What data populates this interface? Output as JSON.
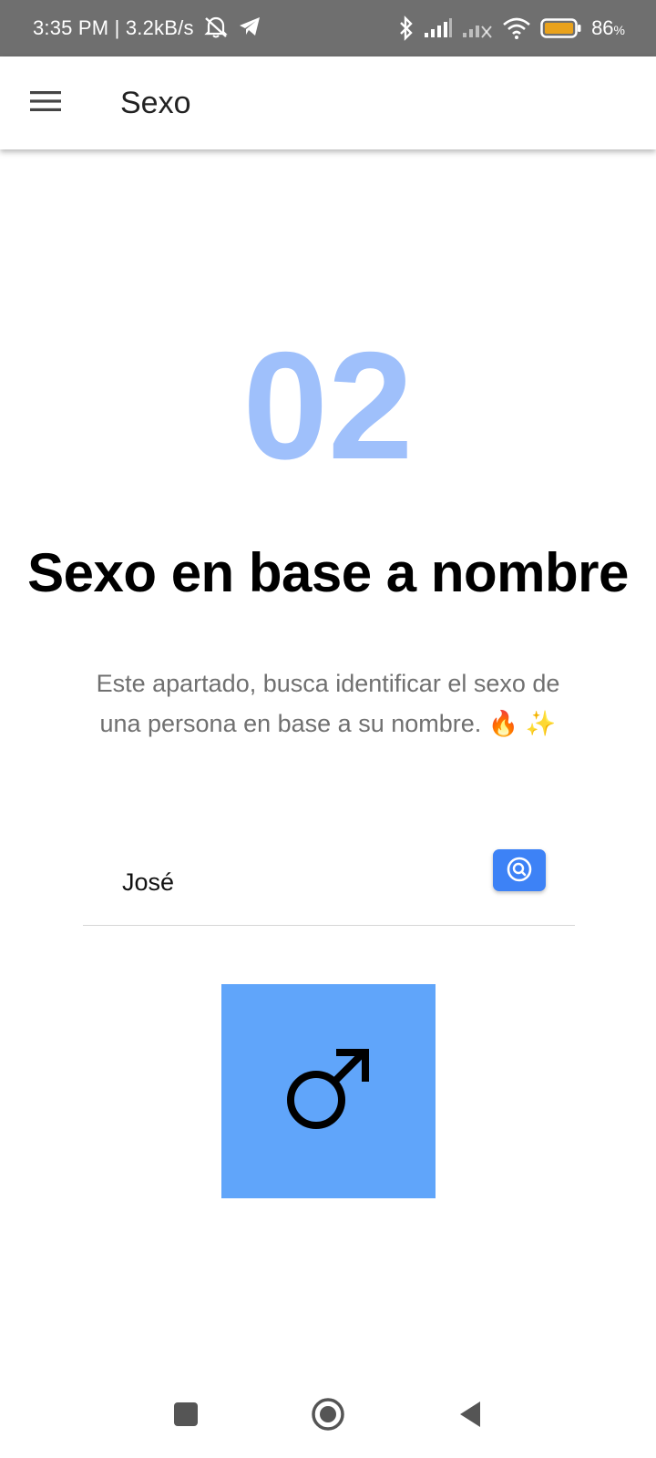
{
  "status_bar": {
    "time_speed": "3:35 PM | 3.2kB/s",
    "battery_percent": "86",
    "battery_unit": "%",
    "icons": [
      "mute-icon",
      "telegram-icon",
      "bluetooth-icon",
      "signal-icon",
      "signal-off-icon",
      "wifi-icon",
      "battery-icon"
    ]
  },
  "app_bar": {
    "title": "Sexo",
    "menu_icon": "hamburger-menu-icon"
  },
  "main": {
    "step_number": "02",
    "headline": "Sexo en base a nombre",
    "description": "Este apartado, busca identificar el sexo de una persona en base a su nombre.",
    "description_emoji": "🔥 ✨"
  },
  "search": {
    "value": "José",
    "button_icon": "search-icon"
  },
  "result": {
    "symbol": "male-symbol-icon"
  },
  "nav_bar": {
    "icons": [
      "recents-icon",
      "home-icon",
      "back-icon"
    ]
  },
  "colors": {
    "status_bar_bg": "#6f6f6f",
    "step_number": "#9fc0fb",
    "search_button": "#3d82f6",
    "result_tile": "#60a5fa",
    "battery_fill": "#e9a21c"
  }
}
